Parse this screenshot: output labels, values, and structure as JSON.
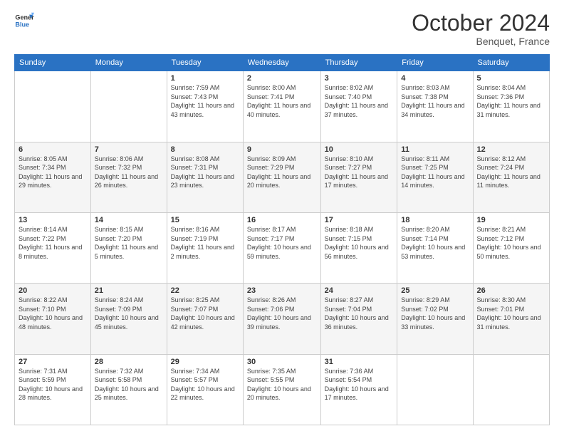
{
  "header": {
    "logo_line1": "General",
    "logo_line2": "Blue",
    "month": "October 2024",
    "location": "Benquet, France"
  },
  "days_of_week": [
    "Sunday",
    "Monday",
    "Tuesday",
    "Wednesday",
    "Thursday",
    "Friday",
    "Saturday"
  ],
  "weeks": [
    [
      {
        "day": "",
        "info": ""
      },
      {
        "day": "",
        "info": ""
      },
      {
        "day": "1",
        "info": "Sunrise: 7:59 AM\nSunset: 7:43 PM\nDaylight: 11 hours and 43 minutes."
      },
      {
        "day": "2",
        "info": "Sunrise: 8:00 AM\nSunset: 7:41 PM\nDaylight: 11 hours and 40 minutes."
      },
      {
        "day": "3",
        "info": "Sunrise: 8:02 AM\nSunset: 7:40 PM\nDaylight: 11 hours and 37 minutes."
      },
      {
        "day": "4",
        "info": "Sunrise: 8:03 AM\nSunset: 7:38 PM\nDaylight: 11 hours and 34 minutes."
      },
      {
        "day": "5",
        "info": "Sunrise: 8:04 AM\nSunset: 7:36 PM\nDaylight: 11 hours and 31 minutes."
      }
    ],
    [
      {
        "day": "6",
        "info": "Sunrise: 8:05 AM\nSunset: 7:34 PM\nDaylight: 11 hours and 29 minutes."
      },
      {
        "day": "7",
        "info": "Sunrise: 8:06 AM\nSunset: 7:32 PM\nDaylight: 11 hours and 26 minutes."
      },
      {
        "day": "8",
        "info": "Sunrise: 8:08 AM\nSunset: 7:31 PM\nDaylight: 11 hours and 23 minutes."
      },
      {
        "day": "9",
        "info": "Sunrise: 8:09 AM\nSunset: 7:29 PM\nDaylight: 11 hours and 20 minutes."
      },
      {
        "day": "10",
        "info": "Sunrise: 8:10 AM\nSunset: 7:27 PM\nDaylight: 11 hours and 17 minutes."
      },
      {
        "day": "11",
        "info": "Sunrise: 8:11 AM\nSunset: 7:25 PM\nDaylight: 11 hours and 14 minutes."
      },
      {
        "day": "12",
        "info": "Sunrise: 8:12 AM\nSunset: 7:24 PM\nDaylight: 11 hours and 11 minutes."
      }
    ],
    [
      {
        "day": "13",
        "info": "Sunrise: 8:14 AM\nSunset: 7:22 PM\nDaylight: 11 hours and 8 minutes."
      },
      {
        "day": "14",
        "info": "Sunrise: 8:15 AM\nSunset: 7:20 PM\nDaylight: 11 hours and 5 minutes."
      },
      {
        "day": "15",
        "info": "Sunrise: 8:16 AM\nSunset: 7:19 PM\nDaylight: 11 hours and 2 minutes."
      },
      {
        "day": "16",
        "info": "Sunrise: 8:17 AM\nSunset: 7:17 PM\nDaylight: 10 hours and 59 minutes."
      },
      {
        "day": "17",
        "info": "Sunrise: 8:18 AM\nSunset: 7:15 PM\nDaylight: 10 hours and 56 minutes."
      },
      {
        "day": "18",
        "info": "Sunrise: 8:20 AM\nSunset: 7:14 PM\nDaylight: 10 hours and 53 minutes."
      },
      {
        "day": "19",
        "info": "Sunrise: 8:21 AM\nSunset: 7:12 PM\nDaylight: 10 hours and 50 minutes."
      }
    ],
    [
      {
        "day": "20",
        "info": "Sunrise: 8:22 AM\nSunset: 7:10 PM\nDaylight: 10 hours and 48 minutes."
      },
      {
        "day": "21",
        "info": "Sunrise: 8:24 AM\nSunset: 7:09 PM\nDaylight: 10 hours and 45 minutes."
      },
      {
        "day": "22",
        "info": "Sunrise: 8:25 AM\nSunset: 7:07 PM\nDaylight: 10 hours and 42 minutes."
      },
      {
        "day": "23",
        "info": "Sunrise: 8:26 AM\nSunset: 7:06 PM\nDaylight: 10 hours and 39 minutes."
      },
      {
        "day": "24",
        "info": "Sunrise: 8:27 AM\nSunset: 7:04 PM\nDaylight: 10 hours and 36 minutes."
      },
      {
        "day": "25",
        "info": "Sunrise: 8:29 AM\nSunset: 7:02 PM\nDaylight: 10 hours and 33 minutes."
      },
      {
        "day": "26",
        "info": "Sunrise: 8:30 AM\nSunset: 7:01 PM\nDaylight: 10 hours and 31 minutes."
      }
    ],
    [
      {
        "day": "27",
        "info": "Sunrise: 7:31 AM\nSunset: 5:59 PM\nDaylight: 10 hours and 28 minutes."
      },
      {
        "day": "28",
        "info": "Sunrise: 7:32 AM\nSunset: 5:58 PM\nDaylight: 10 hours and 25 minutes."
      },
      {
        "day": "29",
        "info": "Sunrise: 7:34 AM\nSunset: 5:57 PM\nDaylight: 10 hours and 22 minutes."
      },
      {
        "day": "30",
        "info": "Sunrise: 7:35 AM\nSunset: 5:55 PM\nDaylight: 10 hours and 20 minutes."
      },
      {
        "day": "31",
        "info": "Sunrise: 7:36 AM\nSunset: 5:54 PM\nDaylight: 10 hours and 17 minutes."
      },
      {
        "day": "",
        "info": ""
      },
      {
        "day": "",
        "info": ""
      }
    ]
  ]
}
